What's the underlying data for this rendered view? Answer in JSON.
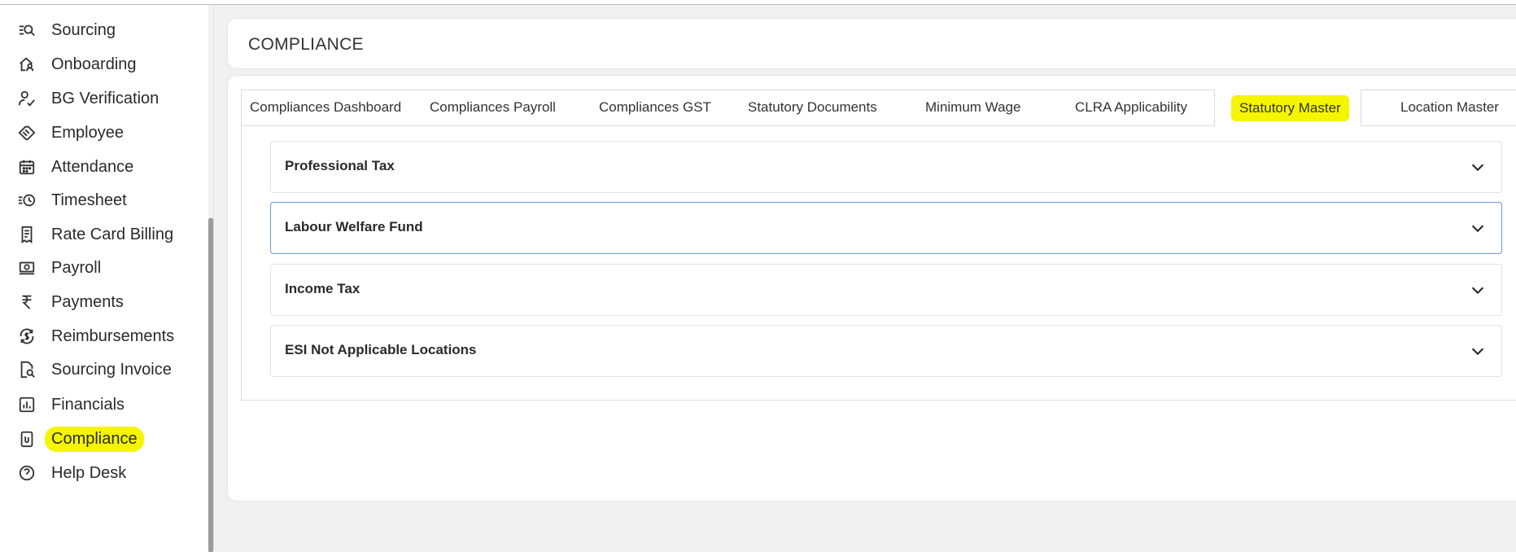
{
  "sidebar": {
    "items": [
      {
        "label": "Sourcing",
        "icon": "sourcing-search-icon"
      },
      {
        "label": "Onboarding",
        "icon": "onboarding-house-user-icon"
      },
      {
        "label": "BG Verification",
        "icon": "user-check-icon"
      },
      {
        "label": "Employee",
        "icon": "handshake-icon"
      },
      {
        "label": "Attendance",
        "icon": "calendar-icon"
      },
      {
        "label": "Timesheet",
        "icon": "clock-list-icon"
      },
      {
        "label": "Rate Card Billing",
        "icon": "receipt-icon"
      },
      {
        "label": "Payroll",
        "icon": "money-icon"
      },
      {
        "label": "Payments",
        "icon": "rupee-icon"
      },
      {
        "label": "Reimbursements",
        "icon": "refund-dollar-icon"
      },
      {
        "label": "Sourcing Invoice",
        "icon": "invoice-search-icon"
      },
      {
        "label": "Financials",
        "icon": "bar-chart-icon"
      },
      {
        "label": "Compliance",
        "icon": "clipboard-icon"
      },
      {
        "label": "Help Desk",
        "icon": "help-icon"
      }
    ],
    "active_index": 12
  },
  "header": {
    "title": "COMPLIANCE"
  },
  "tabs": [
    {
      "label": "Compliances Dashboard"
    },
    {
      "label": "Compliances Payroll"
    },
    {
      "label": "Compliances GST"
    },
    {
      "label": "Statutory Documents"
    },
    {
      "label": "Minimum Wage"
    },
    {
      "label": "CLRA Applicability"
    },
    {
      "label": "Statutory Master"
    },
    {
      "label": "Location Master"
    }
  ],
  "active_tab": "Statutory Master",
  "accordion": [
    {
      "title": "Professional Tax"
    },
    {
      "title": "Labour Welfare Fund"
    },
    {
      "title": "Income Tax"
    },
    {
      "title": "ESI Not Applicable Locations"
    }
  ],
  "colors": {
    "highlight": "#f5f500",
    "focus_border": "#6f97d9"
  }
}
